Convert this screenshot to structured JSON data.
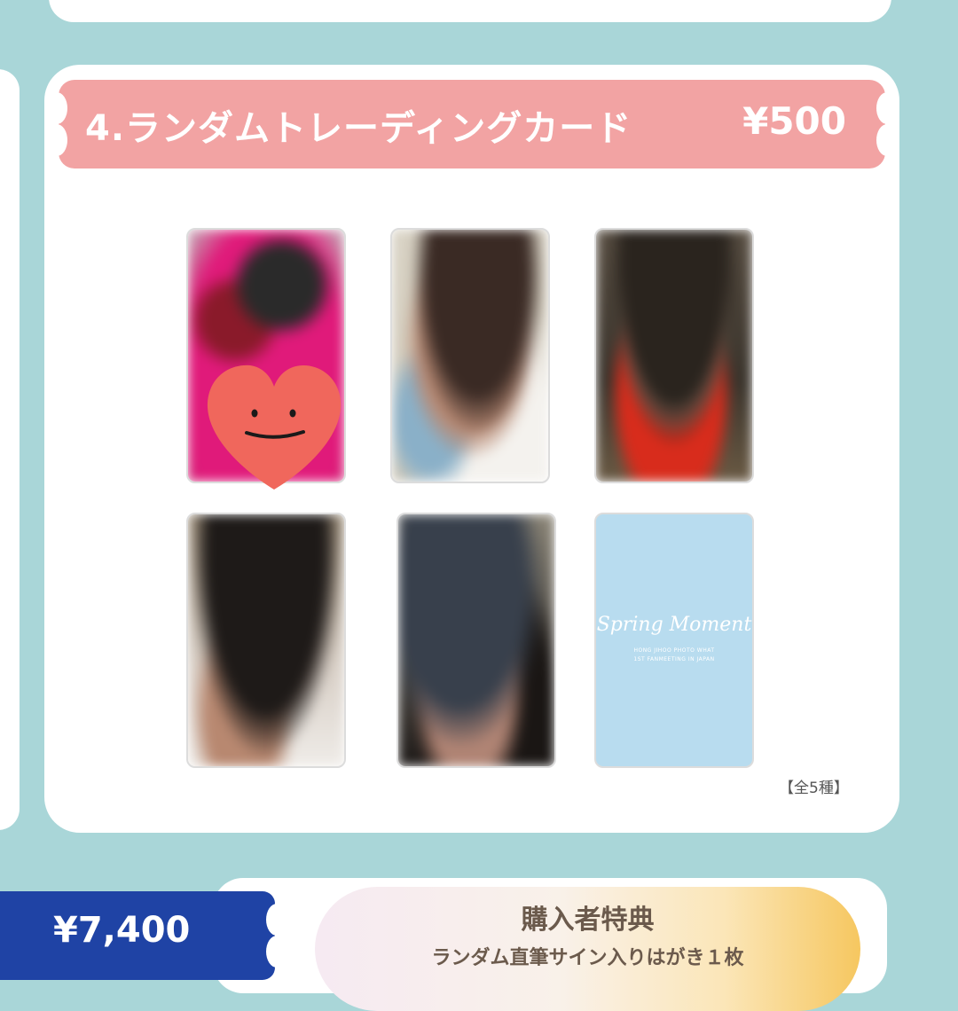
{
  "product_section": {
    "title": "4.ランダムトレーディングカード",
    "price": "¥500",
    "variety_count": "【全5種】",
    "cards": [
      {
        "kind": "photo-blurred",
        "name": "card-1"
      },
      {
        "kind": "photo-blurred",
        "name": "card-2"
      },
      {
        "kind": "photo-blurred",
        "name": "card-3"
      },
      {
        "kind": "photo-blurred",
        "name": "card-4"
      },
      {
        "kind": "photo-blurred",
        "name": "card-5"
      },
      {
        "kind": "card-back",
        "name": "card-6"
      }
    ],
    "card_back": {
      "title": "Spring Moment",
      "subtitle_line1": "HONG JIHOO PHOTO WHAT",
      "subtitle_line2": "1ST FANMEETING IN JAPAN"
    },
    "sticker_icon": "smiling-heart-sticker"
  },
  "bottom": {
    "price": "¥7,400",
    "bonus_title": "購入者特典",
    "bonus_desc": "ランダム直筆サイン入りはがき１枚"
  },
  "colors": {
    "background": "#a9d6d8",
    "banner": "#f2a3a3",
    "ribbon": "#1f43a5",
    "card_back": "#b8dcef"
  }
}
